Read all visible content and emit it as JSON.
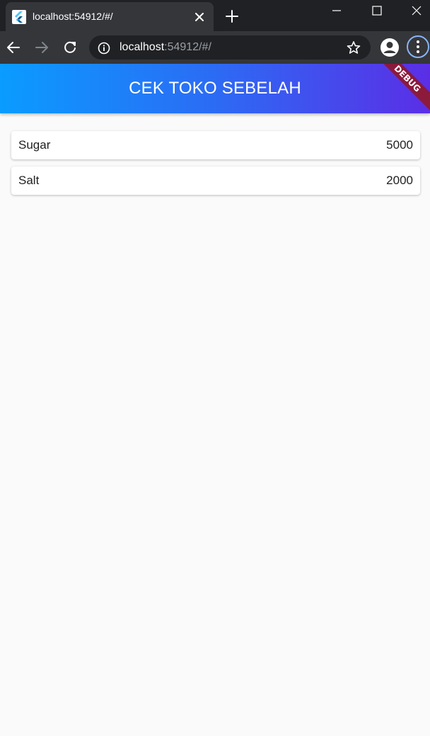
{
  "browser": {
    "tab": {
      "title": "localhost:54912/#/",
      "favicon": "flutter-icon"
    },
    "address_bar": {
      "host": "localhost",
      "path": ":54912/#/"
    },
    "icons": {
      "back": "arrow-left-icon",
      "forward": "arrow-right-icon",
      "reload": "reload-icon",
      "info": "info-icon",
      "bookmark": "star-icon",
      "profile": "account-icon",
      "menu": "three-dots-vertical-icon",
      "new_tab": "plus-icon",
      "tab_close": "close-icon",
      "window_minimize": "minimize-icon",
      "window_maximize": "maximize-icon",
      "window_close": "close-icon"
    }
  },
  "app": {
    "title": "CEK TOKO SEBELAH",
    "debug_banner": "DEBUG",
    "items": [
      {
        "name": "Sugar",
        "price": "5000"
      },
      {
        "name": "Salt",
        "price": "2000"
      }
    ]
  },
  "colors": {
    "appbar_gradient_start": "#0a9cff",
    "appbar_gradient_end": "#5b2ee6",
    "debug_banner": "#8b1a3b",
    "page_background": "#fafafa"
  }
}
